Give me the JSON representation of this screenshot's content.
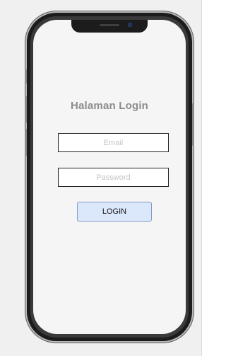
{
  "login": {
    "title": "Halaman Login",
    "email_placeholder": "Email",
    "password_placeholder": "Password",
    "login_button_label": "LOGIN"
  },
  "colors": {
    "screen_background": "#f5f5f5",
    "title_text": "#8c8c8c",
    "button_fill": "#dbe7fb",
    "button_border": "#7f9cc6",
    "phone_frame": "#1c1c1c"
  }
}
